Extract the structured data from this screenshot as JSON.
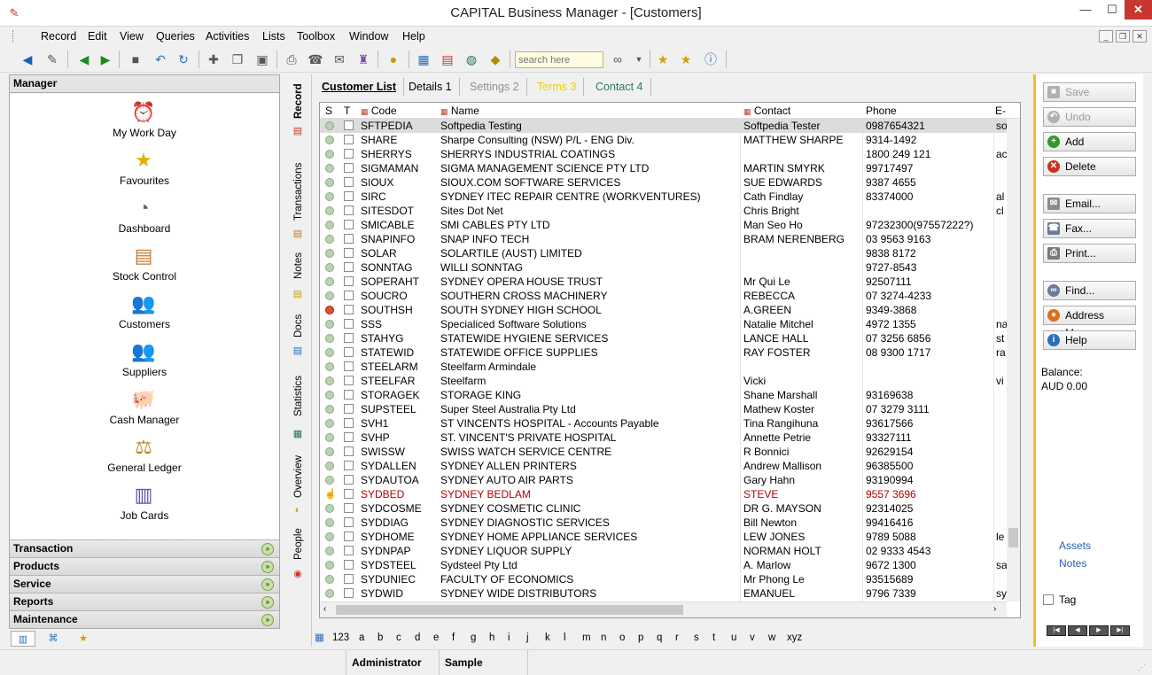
{
  "window": {
    "title": "CAPITAL Business Manager - [Customers]",
    "minimize": "—",
    "maximize": "☐",
    "close": "✕"
  },
  "menu": [
    "Record",
    "Edit",
    "View",
    "Queries",
    "Activities",
    "Lists",
    "Toolbox",
    "Window",
    "Help"
  ],
  "toolbar": {
    "search_placeholder": "search here",
    "icons": [
      "back-icon",
      "forward-toggle-icon",
      "prev-icon",
      "next-icon",
      "save-icon",
      "undo-icon",
      "refresh-icon",
      "add-icon",
      "copy-icon",
      "delete-icon",
      "print-icon",
      "fax-icon",
      "email-icon",
      "wizard-icon",
      "coin-icon",
      "calc-icon",
      "calendar-icon",
      "globe-icon",
      "book-icon",
      "binoculars-icon",
      "dropdown-icon",
      "star-add-icon",
      "star-icon",
      "info-icon"
    ]
  },
  "manager": {
    "title": "Manager",
    "items": [
      {
        "label": "My Work Day",
        "icon": "clock-icon"
      },
      {
        "label": "Favourites",
        "icon": "star-icon"
      },
      {
        "label": "Dashboard",
        "icon": "gauge-icon"
      },
      {
        "label": "Stock Control",
        "icon": "box-icon"
      },
      {
        "label": "Customers",
        "icon": "people-icon"
      },
      {
        "label": "Suppliers",
        "icon": "suppliers-icon"
      },
      {
        "label": "Cash Manager",
        "icon": "piggy-bank-icon"
      },
      {
        "label": "General Ledger",
        "icon": "scales-icon"
      },
      {
        "label": "Job Cards",
        "icon": "job-cards-icon"
      }
    ],
    "sections": [
      "Transaction",
      "Products",
      "Service",
      "Reports",
      "Maintenance"
    ]
  },
  "side_tabs": [
    "Record",
    "Transactions",
    "Notes",
    "Docs",
    "Statistics",
    "Overview",
    "People"
  ],
  "tabs": [
    {
      "label": "Customer List",
      "active": true
    },
    {
      "label": "Details 1"
    },
    {
      "label": "Settings 2",
      "disabled": true
    },
    {
      "label": "Terms 3",
      "highlight": true
    },
    {
      "label": "Contact 4"
    }
  ],
  "grid": {
    "columns": [
      "S",
      "T",
      "Code",
      "Name",
      "Contact",
      "Phone",
      "E-"
    ],
    "rows": [
      {
        "code": "SFTPEDIA",
        "name": "Softpedia Testing",
        "contact": "Softpedia Tester",
        "phone": "0987654321",
        "e": "so",
        "sel": true
      },
      {
        "code": "SHARE",
        "name": "Sharpe Consulting (NSW) P/L - ENG Div.",
        "contact": "MATTHEW SHARPE",
        "phone": "9314-1492",
        "e": ""
      },
      {
        "code": "SHERRYS",
        "name": "SHERRYS INDUSTRIAL COATINGS",
        "contact": "",
        "phone": "1800 249 121",
        "e": "ac"
      },
      {
        "code": "SIGMAMAN",
        "name": "SIGMA MANAGEMENT SCIENCE PTY LTD",
        "contact": "MARTIN SMYRK",
        "phone": "99717497",
        "e": ""
      },
      {
        "code": "SIOUX",
        "name": "SIOUX.COM SOFTWARE SERVICES",
        "contact": "SUE EDWARDS",
        "phone": "9387 4655",
        "e": ""
      },
      {
        "code": "SIRC",
        "name": "SYDNEY ITEC REPAIR CENTRE (WORKVENTURES)",
        "contact": "Cath Findlay",
        "phone": "83374000",
        "e": "al"
      },
      {
        "code": "SITESDOT",
        "name": "Sites Dot Net",
        "contact": "Chris Bright",
        "phone": "",
        "e": "cl"
      },
      {
        "code": "SMICABLE",
        "name": "SMI CABLES PTY LTD",
        "contact": "Man Seo Ho",
        "phone": "97232300(97557222?)",
        "e": ""
      },
      {
        "code": "SNAPINFO",
        "name": "SNAP INFO TECH",
        "contact": "BRAM NERENBERG",
        "phone": "03 9563 9163",
        "e": ""
      },
      {
        "code": "SOLAR",
        "name": "SOLARTILE (AUST) LIMITED",
        "contact": "",
        "phone": "9838 8172",
        "e": ""
      },
      {
        "code": "SONNTAG",
        "name": "WILLI SONNTAG",
        "contact": "",
        "phone": "9727-8543",
        "e": ""
      },
      {
        "code": "SOPERAHT",
        "name": "SYDNEY OPERA HOUSE TRUST",
        "contact": "Mr Qui Le",
        "phone": "92507111",
        "e": ""
      },
      {
        "code": "SOUCRO",
        "name": "SOUTHERN CROSS MACHINERY",
        "contact": "REBECCA",
        "phone": "07 3274-4233",
        "e": ""
      },
      {
        "code": "SOUTHSH",
        "name": "SOUTH SYDNEY HIGH SCHOOL",
        "contact": "A.GREEN",
        "phone": "9349-3868",
        "e": "",
        "status": "red"
      },
      {
        "code": "SSS",
        "name": "Specialiced Software Solutions",
        "contact": "Natalie Mitchel",
        "phone": "4972 1355",
        "e": "na"
      },
      {
        "code": "STAHYG",
        "name": "STATEWIDE HYGIENE SERVICES",
        "contact": "LANCE HALL",
        "phone": "07 3256 6856",
        "e": "st"
      },
      {
        "code": "STATEWID",
        "name": "STATEWIDE OFFICE SUPPLIES",
        "contact": "RAY FOSTER",
        "phone": "08 9300 1717",
        "e": "ra"
      },
      {
        "code": "STEELARM",
        "name": "Steelfarm Armindale",
        "contact": "",
        "phone": "",
        "e": ""
      },
      {
        "code": "STEELFAR",
        "name": "Steelfarm",
        "contact": "Vicki",
        "phone": "",
        "e": "vi"
      },
      {
        "code": "STORAGEK",
        "name": "STORAGE KING",
        "contact": "Shane Marshall",
        "phone": "93169638",
        "e": ""
      },
      {
        "code": "SUPSTEEL",
        "name": "Super Steel Australia Pty Ltd",
        "contact": "Mathew Koster",
        "phone": "07 3279 3111",
        "e": ""
      },
      {
        "code": "SVH1",
        "name": "ST VINCENTS HOSPITAL - Accounts Payable",
        "contact": "Tina Rangihuna",
        "phone": "93617566",
        "e": ""
      },
      {
        "code": "SVHP",
        "name": "ST. VINCENT'S PRIVATE HOSPITAL",
        "contact": "Annette Petrie",
        "phone": "93327111",
        "e": ""
      },
      {
        "code": "SWISSW",
        "name": "SWISS WATCH SERVICE CENTRE",
        "contact": "R Bonnici",
        "phone": "92629154",
        "e": ""
      },
      {
        "code": "SYDALLEN",
        "name": "SYDNEY ALLEN PRINTERS",
        "contact": "Andrew Mallison",
        "phone": "96385500",
        "e": ""
      },
      {
        "code": "SYDAUTOA",
        "name": "SYDNEY AUTO AIR PARTS",
        "contact": "Gary Hahn",
        "phone": "93190994",
        "e": ""
      },
      {
        "code": "SYDBED",
        "name": "SYDNEY BEDLAM",
        "contact": "STEVE",
        "phone": "9557 3696",
        "e": "",
        "red": true,
        "status": "hand"
      },
      {
        "code": "SYDCOSME",
        "name": "SYDNEY COSMETIC CLINIC",
        "contact": "DR G. MAYSON",
        "phone": "92314025",
        "e": ""
      },
      {
        "code": "SYDDIAG",
        "name": "SYDNEY DIAGNOSTIC SERVICES",
        "contact": "Bill Newton",
        "phone": "99416416",
        "e": ""
      },
      {
        "code": "SYDHOME",
        "name": "SYDNEY HOME APPLIANCE SERVICES",
        "contact": "LEW JONES",
        "phone": "9789 5088",
        "e": "le"
      },
      {
        "code": "SYDNPAP",
        "name": "SYDNEY LIQUOR SUPPLY",
        "contact": "NORMAN HOLT",
        "phone": "02 9333 4543",
        "e": ""
      },
      {
        "code": "SYDSTEEL",
        "name": "Sydsteel Pty Ltd",
        "contact": "A. Marlow",
        "phone": "9672 1300",
        "e": "sa"
      },
      {
        "code": "SYDUNIEC",
        "name": "FACULTY OF ECONOMICS",
        "contact": "Mr Phong Le",
        "phone": "93515689",
        "e": ""
      },
      {
        "code": "SYDWID",
        "name": "SYDNEY WIDE DISTRIBUTORS",
        "contact": "EMANUEL",
        "phone": "9796 7339",
        "e": "sy"
      }
    ]
  },
  "alphabet": [
    "123",
    "a",
    "b",
    "c",
    "d",
    "e",
    "f",
    "g",
    "h",
    "i",
    "j",
    "k",
    "l",
    "m",
    "n",
    "o",
    "p",
    "q",
    "r",
    "s",
    "t",
    "u",
    "v",
    "w",
    "xyz"
  ],
  "actions": {
    "save": "Save",
    "undo": "Undo",
    "add": "Add",
    "delete": "Delete",
    "email": "Email...",
    "fax": "Fax...",
    "print": "Print...",
    "find": "Find...",
    "address_map": "Address Map...",
    "help": "Help"
  },
  "balance": {
    "label": "Balance:",
    "value": "AUD 0.00"
  },
  "links": {
    "assets": "Assets",
    "notes": "Notes"
  },
  "tag_label": "Tag",
  "nav": [
    "|◀",
    "◀",
    "▶",
    "▶|"
  ],
  "status": {
    "user": "Administrator",
    "company": "Sample"
  },
  "colors": {
    "accent_yellow": "#f0c020",
    "selected_row": "#dcdcdc",
    "red_row": "#b00000"
  }
}
